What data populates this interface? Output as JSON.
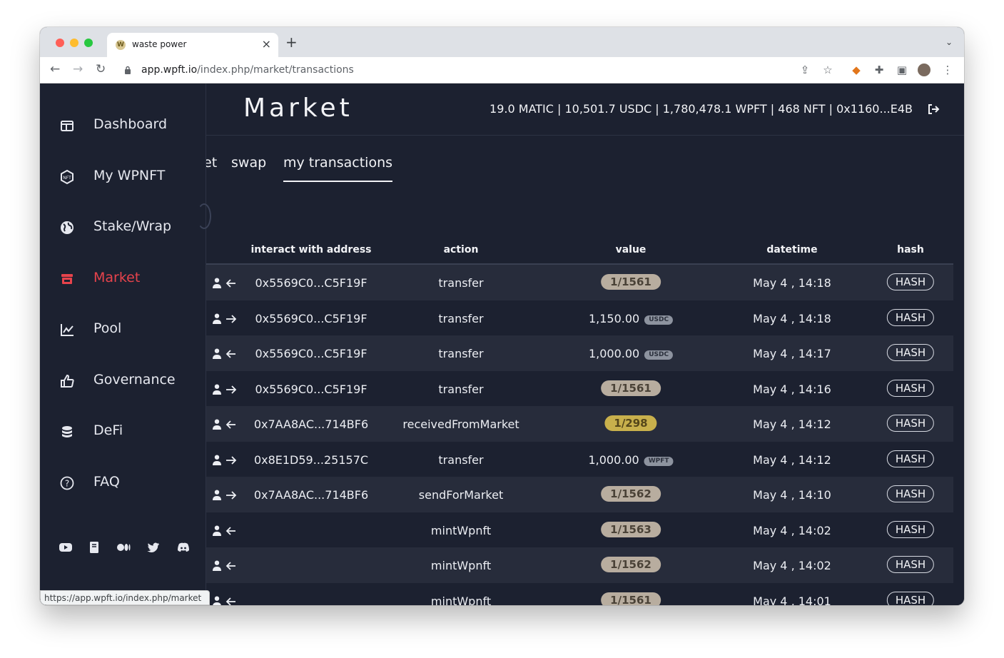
{
  "browser": {
    "tab_title": "waste power",
    "tab_favicon_letter": "W",
    "url_host": "app.wpft.io",
    "url_path": "/index.php/market/transactions",
    "status_url": "https://app.wpft.io/index.php/market"
  },
  "sidebar": {
    "items": [
      {
        "label": "Dashboard",
        "icon": "dashboard-icon"
      },
      {
        "label": "My WPNFT",
        "icon": "nft-icon"
      },
      {
        "label": "Stake/Wrap",
        "icon": "globe-icon"
      },
      {
        "label": "Market",
        "icon": "store-icon",
        "active": true
      },
      {
        "label": "Pool",
        "icon": "chart-line-icon"
      },
      {
        "label": "Governance",
        "icon": "thumbs-up-icon"
      },
      {
        "label": "DeFi",
        "icon": "coins-icon"
      },
      {
        "label": "FAQ",
        "icon": "question-icon"
      }
    ],
    "socials": [
      "youtube-icon",
      "book-icon",
      "medium-icon",
      "twitter-icon",
      "discord-icon"
    ],
    "active_color": "#e7434c"
  },
  "header": {
    "title": "Market",
    "balances": "19.0 MATIC | 10,501.7 USDC | 1,780,478.1 WPFT | 468 NFT | 0x1160...E4B"
  },
  "tabs": [
    {
      "label": "et"
    },
    {
      "label": "swap"
    },
    {
      "label": "my transactions",
      "active": true
    }
  ],
  "table": {
    "columns": [
      "interact with address",
      "action",
      "value",
      "datetime",
      "hash"
    ],
    "rows": [
      {
        "direction": "in",
        "address": "0x5569C0...C5F19F",
        "action": "transfer",
        "value": "1/1561",
        "value_kind": "nft",
        "datetime": "May 4 , 14:18",
        "hash": "HASH"
      },
      {
        "direction": "out",
        "address": "0x5569C0...C5F19F",
        "action": "transfer",
        "value": "1,150.00",
        "token": "USDC",
        "value_kind": "token",
        "datetime": "May 4 , 14:18",
        "hash": "HASH"
      },
      {
        "direction": "in",
        "address": "0x5569C0...C5F19F",
        "action": "transfer",
        "value": "1,000.00",
        "token": "USDC",
        "value_kind": "token",
        "datetime": "May 4 , 14:17",
        "hash": "HASH"
      },
      {
        "direction": "out",
        "address": "0x5569C0...C5F19F",
        "action": "transfer",
        "value": "1/1561",
        "value_kind": "nft",
        "datetime": "May 4 , 14:16",
        "hash": "HASH"
      },
      {
        "direction": "in",
        "address": "0x7AA8AC...714BF6",
        "action": "receivedFromMarket",
        "value": "1/298",
        "value_kind": "nft-gold",
        "datetime": "May 4 , 14:12",
        "hash": "HASH"
      },
      {
        "direction": "out",
        "address": "0x8E1D59...25157C",
        "action": "transfer",
        "value": "1,000.00",
        "token": "WPFT",
        "value_kind": "token",
        "datetime": "May 4 , 14:12",
        "hash": "HASH"
      },
      {
        "direction": "out",
        "address": "0x7AA8AC...714BF6",
        "action": "sendForMarket",
        "value": "1/1562",
        "value_kind": "nft",
        "datetime": "May 4 , 14:10",
        "hash": "HASH"
      },
      {
        "direction": "in",
        "address": "",
        "action": "mintWpnft",
        "value": "1/1563",
        "value_kind": "nft",
        "datetime": "May 4 , 14:02",
        "hash": "HASH"
      },
      {
        "direction": "in",
        "address": "",
        "action": "mintWpnft",
        "value": "1/1562",
        "value_kind": "nft",
        "datetime": "May 4 , 14:02",
        "hash": "HASH"
      },
      {
        "direction": "in",
        "address": "",
        "action": "mintWpnft",
        "value": "1/1561",
        "value_kind": "nft",
        "datetime": "May 4 , 14:01",
        "hash": "HASH"
      }
    ]
  }
}
